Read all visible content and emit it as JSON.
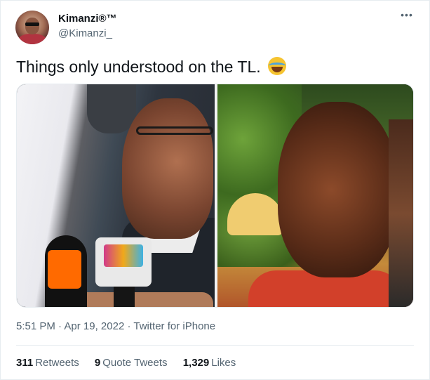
{
  "author": {
    "display_name": "Kimanzi®™",
    "handle": "@Kimanzi_",
    "avatar_icon": "profile-photo"
  },
  "more_icon": "more-options-icon",
  "tweet": {
    "text": "Things only understood on the TL.",
    "emoji": "face-with-tears-of-joy"
  },
  "meta": {
    "time": "5:51 PM",
    "dot1": "·",
    "date": "Apr 19, 2022",
    "dot2": "·",
    "source": "Twitter for iPhone"
  },
  "stats": {
    "retweets_count": "311",
    "retweets_label": "Retweets",
    "quotes_count": "9",
    "quotes_label": "Quote Tweets",
    "likes_count": "1,329",
    "likes_label": "Likes"
  },
  "colors": {
    "primary_text": "#0f1419",
    "secondary_text": "#536471",
    "border": "#e6ecf0"
  }
}
